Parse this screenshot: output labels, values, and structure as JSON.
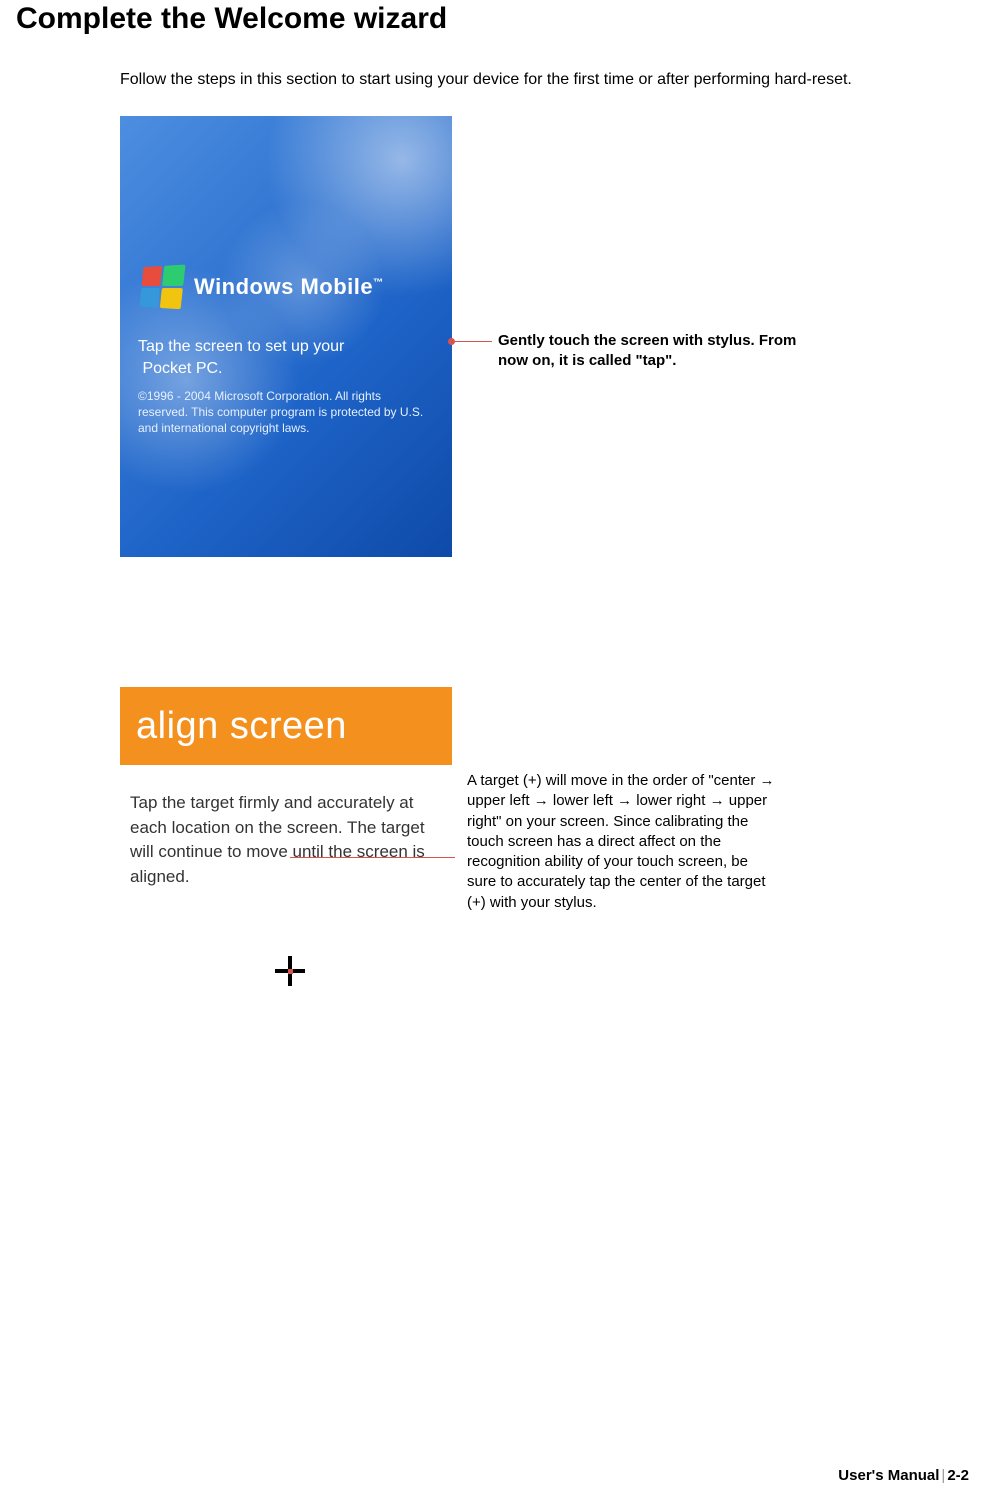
{
  "title": "Complete the Welcome wizard",
  "intro": "Follow the steps in this section to start using your device for the first time or after performing hard-reset.",
  "screenshot1": {
    "brand": "Windows Mobile",
    "tap_line1": "Tap the screen to set up your",
    "tap_line2": "Pocket PC.",
    "copyright": "©1996 - 2004 Microsoft Corporation. All rights reserved.  This computer program is protected by U.S. and international copyright laws."
  },
  "callout1": "Gently touch the screen with stylus. From now on, it is called \"tap\".",
  "screenshot2": {
    "header": "align screen",
    "body": "Tap the target firmly and accurately at each location on the screen. The target will continue to move until the screen is aligned."
  },
  "callout2": "A target (+) will move in the order of \"center → upper left → lower left → lower right → upper right\" on your screen. Since calibrating the touch screen has a direct affect on the recognition ability of your touch screen, be sure to accurately tap the center of the target (+) with your stylus.",
  "footer": {
    "label": "User's Manual",
    "page": "2-2"
  }
}
